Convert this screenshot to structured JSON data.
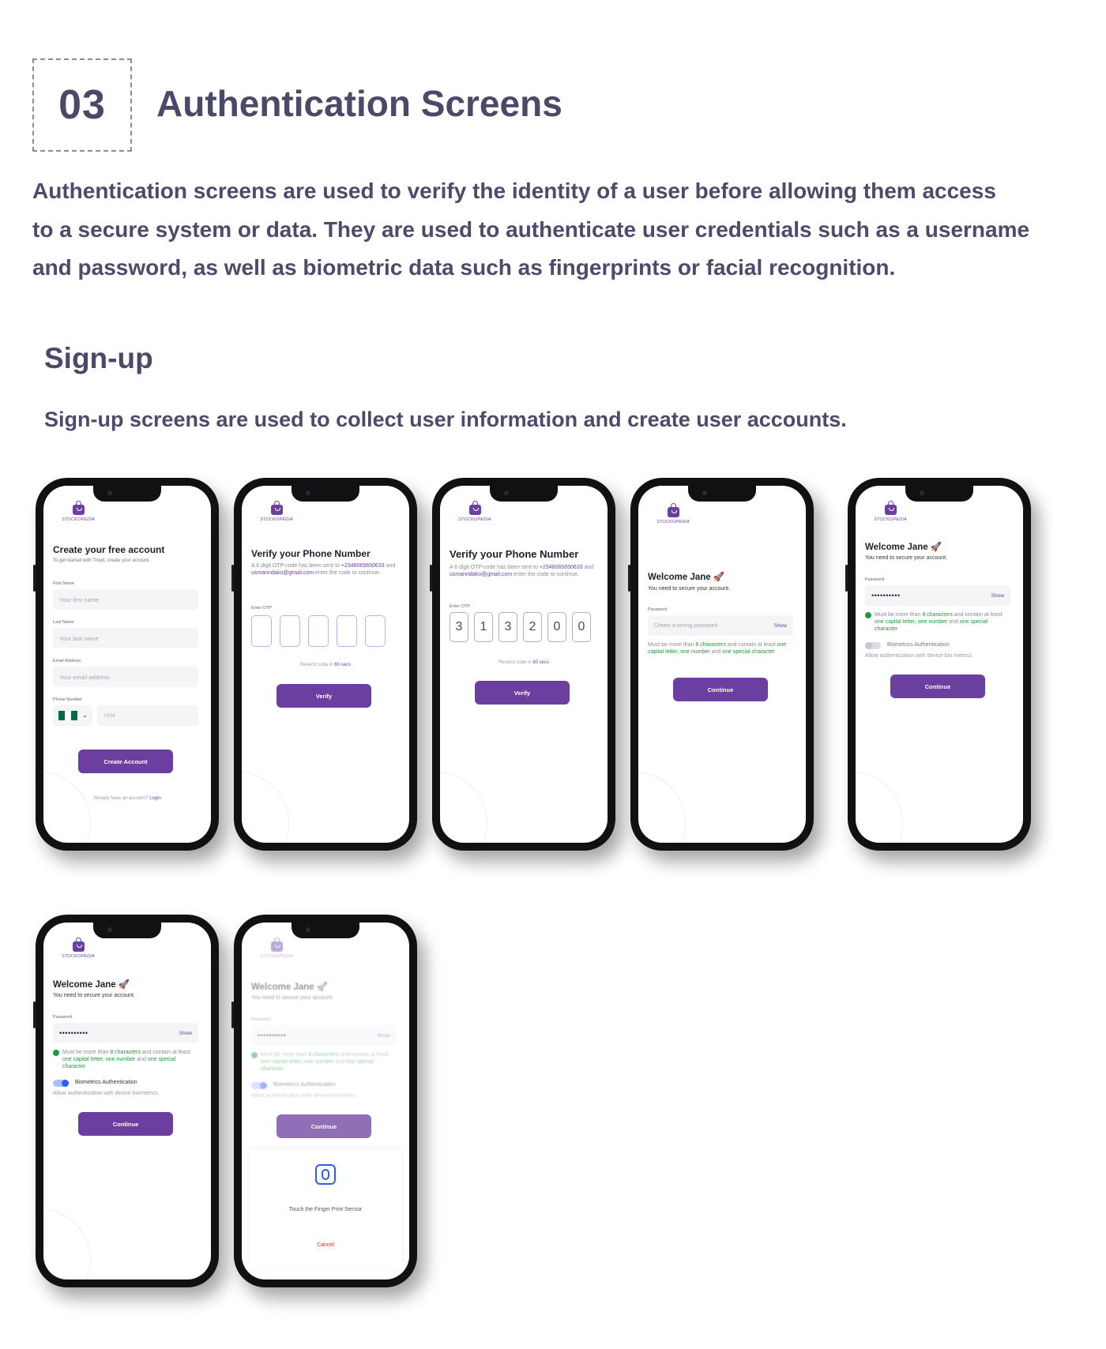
{
  "section": {
    "number": "03",
    "title": "Authentication Screens",
    "intro_lines": [
      "Authentication screens are used to verify the identity of a user before allowing them access",
      "to a secure system or data. They are used to authenticate user credentials such as a username",
      "and password, as well as biometric data such as fingerprints or facial recognition."
    ]
  },
  "signup": {
    "title": "Sign-up",
    "description": "Sign-up screens are used to collect user information and create user accounts."
  },
  "brand": {
    "logo_text": "STOCKOPEDIA",
    "accent": "#6b3fa0"
  },
  "screen1": {
    "title": "Create your free account",
    "subtitle": "To get started with Treyd, create your account.",
    "first_name_label": "First Name",
    "first_name_placeholder": "Your first name",
    "last_name_label": "Last Name",
    "last_name_placeholder": "Your last name",
    "email_label": "Email Address",
    "email_placeholder": "Your email address",
    "phone_label": "Phone Number",
    "phone_placeholder": "+234",
    "button": "Create Account",
    "footer_text": "Already have an account?",
    "footer_link": "Login"
  },
  "screen2": {
    "title": "Verify your Phone Number",
    "help_pre": "A 6 digit OTP code has been sent to",
    "phone": "+2348065650633",
    "and": "and",
    "email": "usmanndako@gmail.com",
    "help_post": "enter the code to continue.",
    "otp_label": "Enter OTP",
    "resend": "Resend code in",
    "resend_time": "60 secs",
    "button": "Verify"
  },
  "screen3": {
    "title": "Verify your Phone Number",
    "help_pre": "A 6 digit OTP code has been sent to",
    "phone": "+2348065650633",
    "and": "and",
    "email": "usmanndako@gmail.com",
    "help_post": "enter the code to continue.",
    "otp_label": "Enter OTP",
    "otp_digits": [
      "3",
      "1",
      "3",
      "2",
      "0",
      "0"
    ],
    "resend": "Resend code in",
    "resend_time": "60 secs",
    "button": "Verify"
  },
  "screen4": {
    "title": "Welcome Jane 🚀",
    "subtitle": "You need to secure your account.",
    "password_label": "Password",
    "password_placeholder": "Create a strong password",
    "show": "Show",
    "rule_a": "Must be more than",
    "rule_b": "8 characters",
    "rule_c": "and contain at least",
    "rule_d": "one capital letter, one number",
    "rule_e": "and",
    "rule_f": "one special character",
    "button": "Continue"
  },
  "screen5": {
    "title": "Welcome Jane 🚀",
    "subtitle": "You need to secure your account.",
    "password_label": "Password",
    "password_value": "••••••••••",
    "show": "Show",
    "rule_a": "Must be more than",
    "rule_b": "8 characters",
    "rule_c": "and contain at least",
    "rule_d": "one capital letter, one number",
    "rule_e": "and",
    "rule_f": "one special character",
    "bio_label": "Biometrics Authentication",
    "bio_help": "Allow authentication with device bio metrics.",
    "button": "Continue"
  },
  "screen6": {
    "title": "Welcome Jane 🚀",
    "subtitle": "You need to secure your account.",
    "password_label": "Password",
    "password_value": "••••••••••",
    "show": "Show",
    "rule_a": "Must be more than",
    "rule_b": "8 characters",
    "rule_c": "and contain at least",
    "rule_d": "one capital letter, one number",
    "rule_e": "and",
    "rule_f": "one special character",
    "bio_label": "Biometrics Authentication",
    "bio_help": "Allow authentication with device biometrics.",
    "button": "Continue"
  },
  "screen7": {
    "title": "Welcome Jane 🚀",
    "subtitle": "You need to secure your account.",
    "password_label": "Password",
    "password_value": "••••••••••",
    "show": "Show",
    "rule_a": "Must be more than",
    "rule_b": "8 characters",
    "rule_c": "and contain at least",
    "rule_d": "one capital letter, one number",
    "rule_e": "and",
    "rule_f": "one special character",
    "bio_label": "Biometrics Authentication",
    "bio_help": "Allow authentication with device biometrics.",
    "button": "Continue",
    "sheet_text": "Touch the Finger Print Sensor",
    "cancel": "Cancel"
  }
}
